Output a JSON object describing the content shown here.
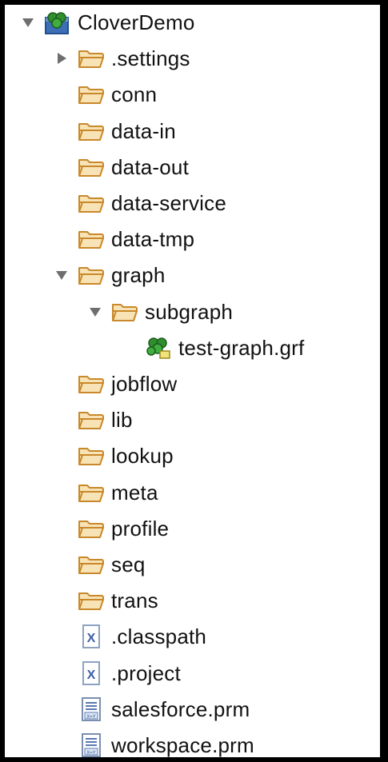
{
  "colors": {
    "background": "#000000",
    "panel": "#ffffff",
    "text": "#111111",
    "folder_fill": "#f7e3b5",
    "folder_stroke": "#c9882a",
    "twisty": "#6e6e6e",
    "clover_green": "#2f8f2f",
    "project_blue": "#3d6fb6"
  },
  "tree": [
    {
      "label": "CloverDemo",
      "icon": "clover-project-icon",
      "twisty": "expanded",
      "level": 0
    },
    {
      "label": ".settings",
      "icon": "folder-icon",
      "twisty": "collapsed",
      "level": 1
    },
    {
      "label": "conn",
      "icon": "folder-icon",
      "twisty": "none",
      "level": 1
    },
    {
      "label": "data-in",
      "icon": "folder-icon",
      "twisty": "none",
      "level": 1
    },
    {
      "label": "data-out",
      "icon": "folder-icon",
      "twisty": "none",
      "level": 1
    },
    {
      "label": "data-service",
      "icon": "folder-icon",
      "twisty": "none",
      "level": 1
    },
    {
      "label": "data-tmp",
      "icon": "folder-icon",
      "twisty": "none",
      "level": 1
    },
    {
      "label": "graph",
      "icon": "folder-icon",
      "twisty": "expanded",
      "level": 1
    },
    {
      "label": "subgraph",
      "icon": "folder-icon",
      "twisty": "expanded",
      "level": 2
    },
    {
      "label": "test-graph.grf",
      "icon": "clover-graph-icon",
      "twisty": "none",
      "level": 3
    },
    {
      "label": "jobflow",
      "icon": "folder-icon",
      "twisty": "none",
      "level": 1
    },
    {
      "label": "lib",
      "icon": "folder-icon",
      "twisty": "none",
      "level": 1
    },
    {
      "label": "lookup",
      "icon": "folder-icon",
      "twisty": "none",
      "level": 1
    },
    {
      "label": "meta",
      "icon": "folder-icon",
      "twisty": "none",
      "level": 1
    },
    {
      "label": "profile",
      "icon": "folder-icon",
      "twisty": "none",
      "level": 1
    },
    {
      "label": "seq",
      "icon": "folder-icon",
      "twisty": "none",
      "level": 1
    },
    {
      "label": "trans",
      "icon": "folder-icon",
      "twisty": "none",
      "level": 1
    },
    {
      "label": ".classpath",
      "icon": "xml-file-icon",
      "twisty": "none",
      "level": 1
    },
    {
      "label": ".project",
      "icon": "xml-file-icon",
      "twisty": "none",
      "level": 1
    },
    {
      "label": "salesforce.prm",
      "icon": "parameter-file-icon",
      "twisty": "none",
      "level": 1
    },
    {
      "label": "workspace.prm",
      "icon": "parameter-file-icon",
      "twisty": "none",
      "level": 1
    }
  ]
}
